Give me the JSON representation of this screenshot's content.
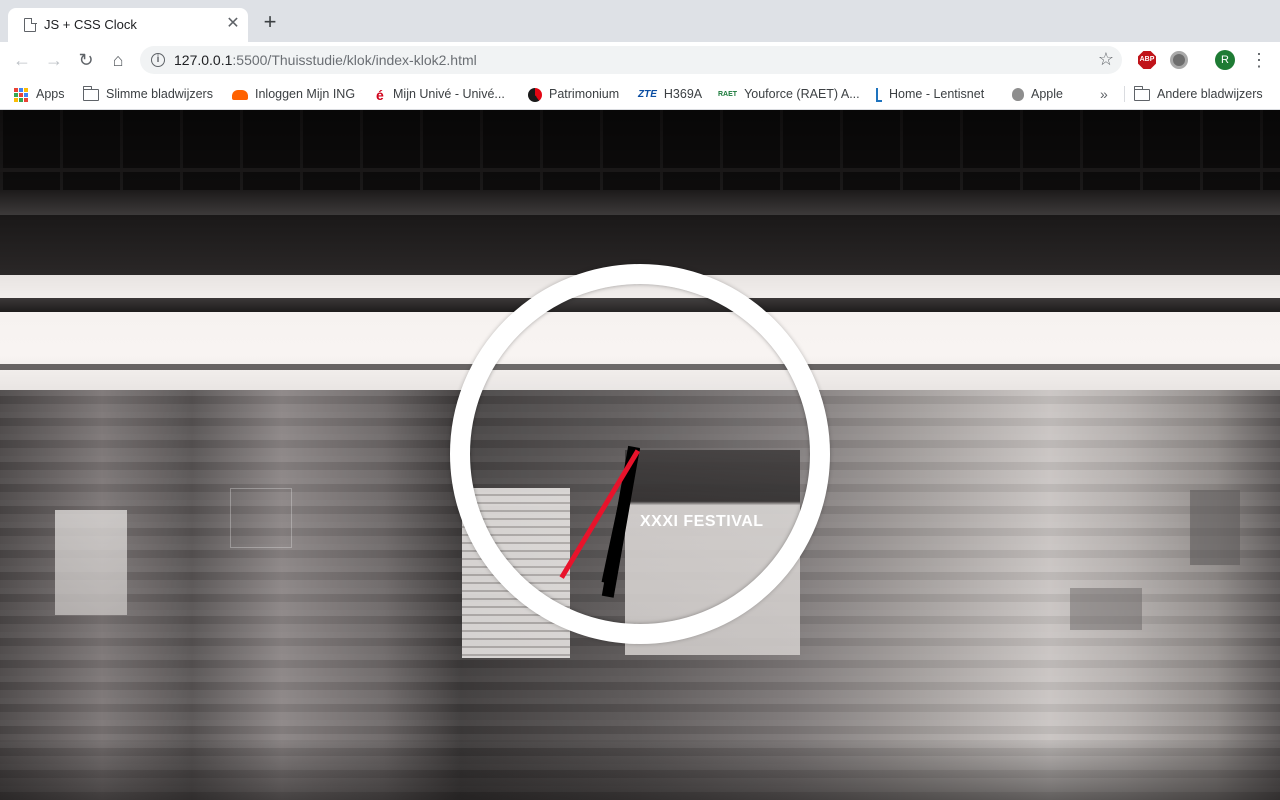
{
  "tab": {
    "title": "JS + CSS Clock",
    "close_label": "✕",
    "new_tab_label": "+"
  },
  "toolbar": {
    "url_host": "127.0.0.1",
    "url_rest": ":5500/Thuisstudie/klok/index-klok2.html",
    "avatar_initial": "R",
    "abp_label": "ABP"
  },
  "bookmarks": {
    "items": [
      {
        "label": "Apps",
        "icon": "apps-grid-icon"
      },
      {
        "label": "Slimme bladwijzers",
        "icon": "folder-icon"
      },
      {
        "label": "Inloggen Mijn ING",
        "icon": "ing-lion-icon"
      },
      {
        "label": "Mijn Univé - Univé...",
        "icon": "unive-icon"
      },
      {
        "label": "Patrimonium",
        "icon": "patrimonium-icon"
      },
      {
        "label": "H369A",
        "icon": "zte-icon"
      },
      {
        "label": "Youforce (RAET) A...",
        "icon": "raet-icon"
      },
      {
        "label": "Home - Lentisnet",
        "icon": "lentis-icon"
      },
      {
        "label": "Apple",
        "icon": "apple-icon"
      }
    ],
    "overflow_label": "»",
    "other_label": "Andere bladwijzers",
    "zte_mark": "ZTE",
    "raet_mark": "RAET"
  },
  "page": {
    "background_text": "XXXI FESTIVAL",
    "clock": {
      "hour_angle_deg": 100,
      "minute_angle_deg": 102,
      "second_angle_deg": 121
    }
  },
  "colors": {
    "second_hand": "#e8132b",
    "hour_minute_hands": "#000000",
    "clock_ring": "#ffffff",
    "avatar": "#1e7b34"
  }
}
